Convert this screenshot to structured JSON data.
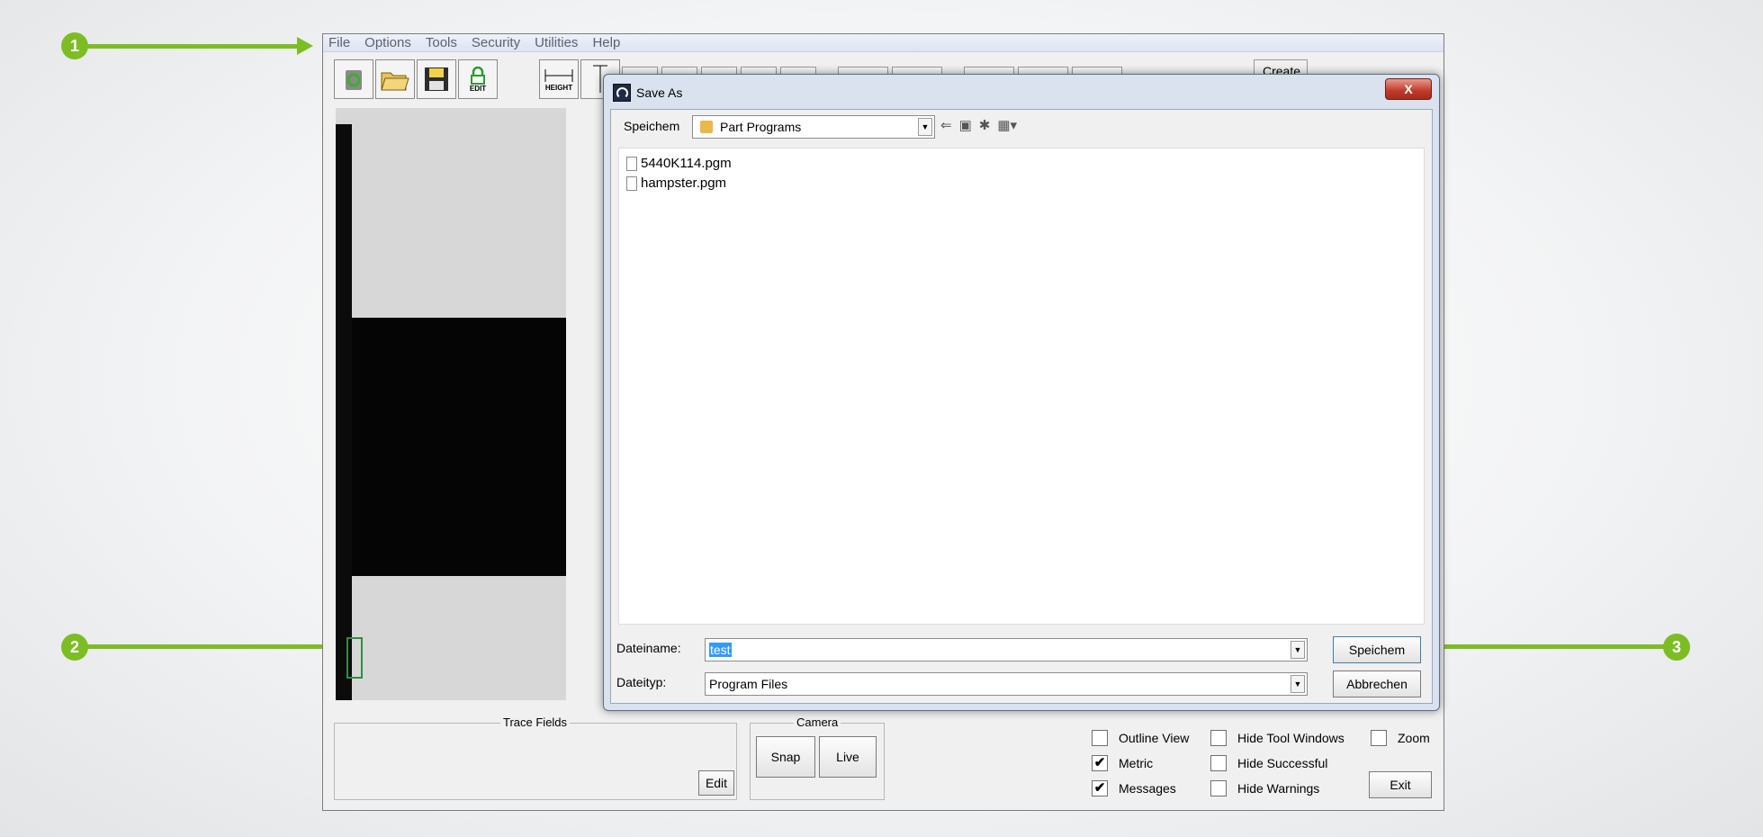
{
  "menu": [
    "File",
    "Options",
    "Tools",
    "Security",
    "Utilities",
    "Help"
  ],
  "toolbar": {
    "height_label": "HEIGHT",
    "edit_label": "EDIT",
    "create_label": "Create"
  },
  "dialog": {
    "title": "Save As",
    "close_label": "X",
    "save_in_label": "Speichem",
    "folder": "Part Programs",
    "files": [
      "5440K114.pgm",
      "hampster.pgm"
    ],
    "filename_label": "Dateiname:",
    "filename_value": "test",
    "filetype_label": "Dateityp:",
    "filetype_value": "Program Files",
    "save_button": "Speichem",
    "cancel_button": "Abbrechen"
  },
  "bottom": {
    "trace_fields_label": "Trace Fields",
    "edit_button": "Edit",
    "camera_label": "Camera",
    "snap_button": "Snap",
    "live_button": "Live",
    "outline_view": "Outline View",
    "metric": "Metric",
    "messages": "Messages",
    "hide_tool_windows": "Hide Tool Windows",
    "hide_successful": "Hide Successful",
    "hide_warnings": "Hide Warnings",
    "zoom": "Zoom",
    "exit_button": "Exit",
    "check_mark": "✔"
  },
  "callouts": [
    "1",
    "2",
    "3"
  ],
  "colors": {
    "callout_green": "#7dbd24"
  }
}
